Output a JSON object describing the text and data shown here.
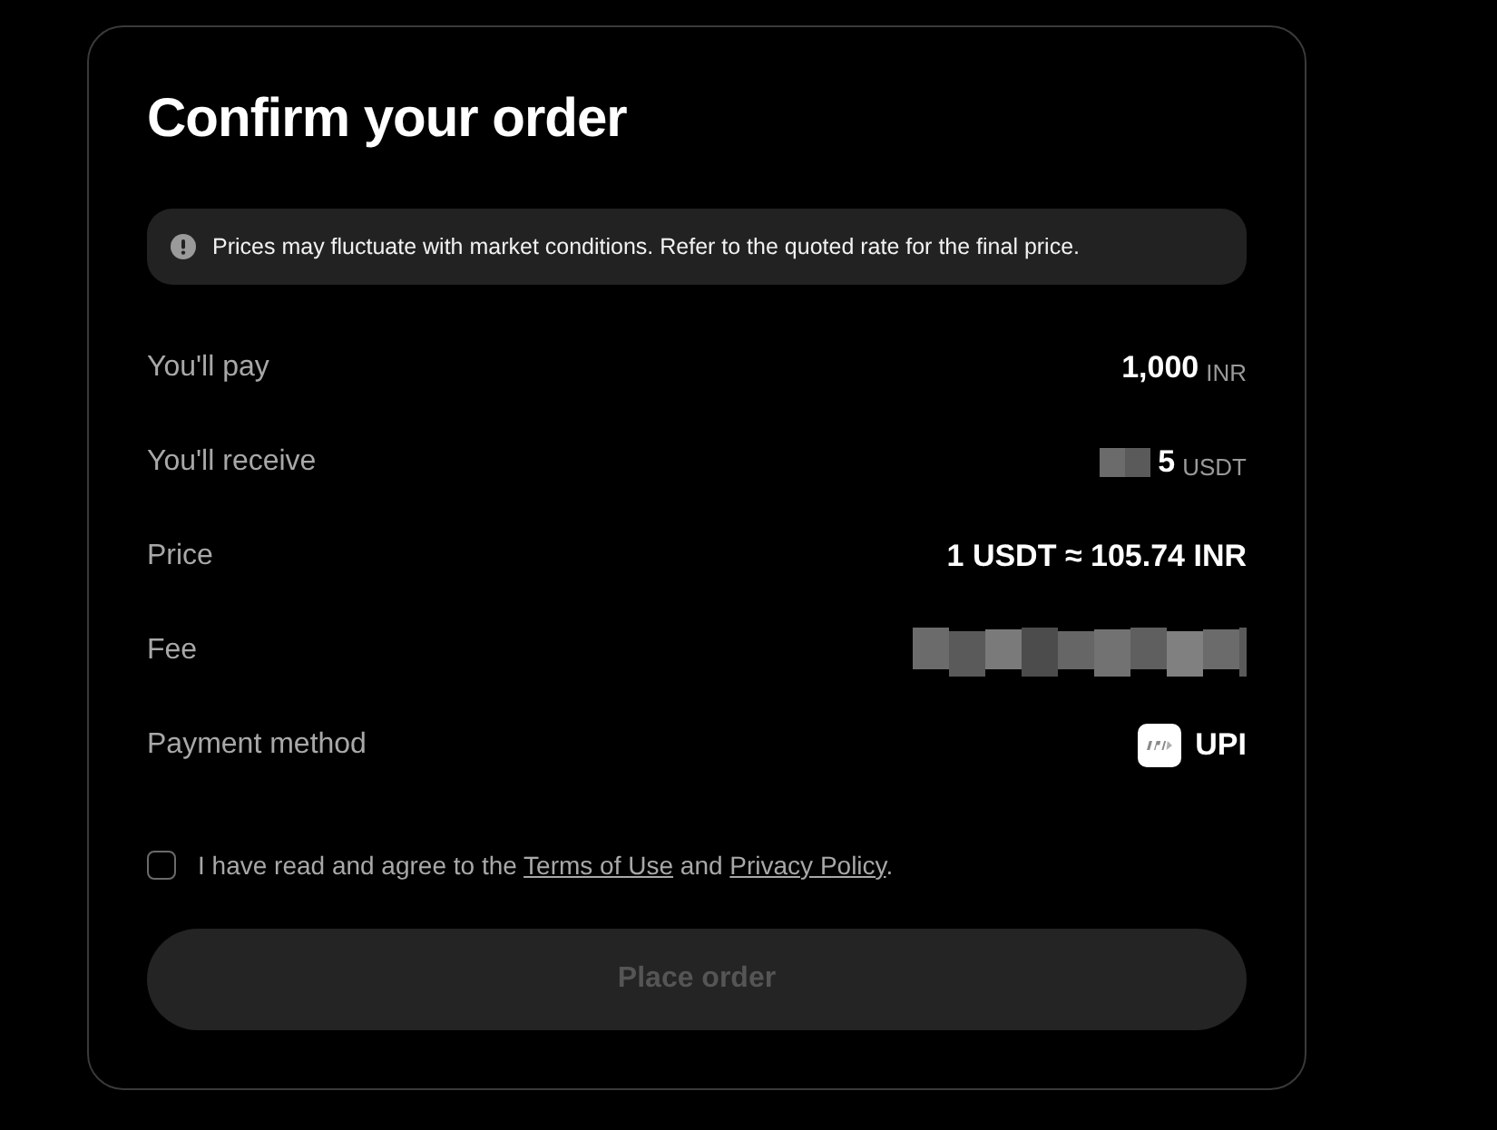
{
  "title": "Confirm your order",
  "notice": {
    "text": "Prices may fluctuate with market conditions. Refer to the quoted rate for the final price."
  },
  "details": [
    {
      "kind": "amount",
      "label": "You'll pay",
      "amount": "1,000",
      "unit": "INR",
      "redacted": false
    },
    {
      "kind": "amount",
      "label": "You'll receive",
      "amount": "5",
      "unit": "USDT",
      "redacted": true
    },
    {
      "kind": "rate",
      "label": "Price",
      "value": "1 USDT ≈ 105.74 INR"
    },
    {
      "kind": "amount",
      "label": "Fee",
      "redacted": true
    },
    {
      "kind": "method",
      "label": "Payment method",
      "value": "UPI"
    }
  ],
  "agreement": {
    "checked": false,
    "parts": [
      {
        "kind": "text",
        "text": "I have read and agree to the "
      },
      {
        "kind": "link",
        "text": "Terms of Use"
      },
      {
        "kind": "text",
        "text": " and "
      },
      {
        "kind": "link",
        "text": "Privacy Policy"
      },
      {
        "kind": "text",
        "text": "."
      }
    ]
  },
  "button": {
    "label": "Place order",
    "disabled": true
  }
}
